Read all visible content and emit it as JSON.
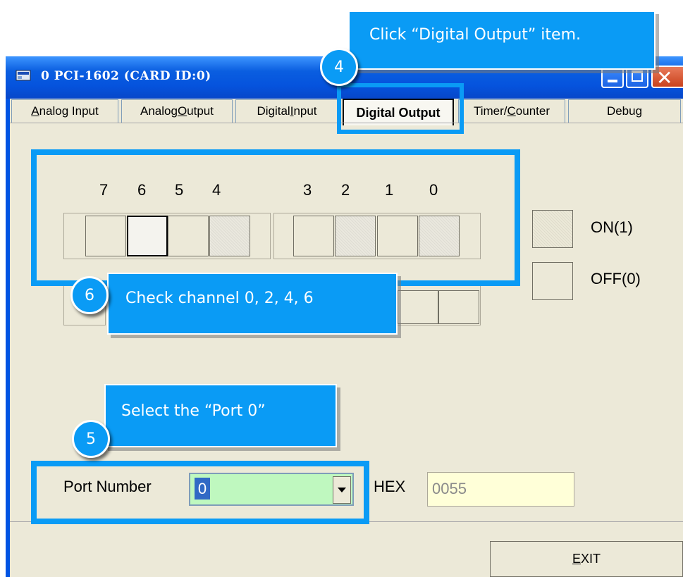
{
  "window": {
    "title": "0 PCI-1602 (CARD ID:0)",
    "close_glyph": "✕"
  },
  "tabs": [
    {
      "pre": "",
      "key": "A",
      "post": "nalog Input",
      "active": false
    },
    {
      "pre": "Analog ",
      "key": "O",
      "post": "utput",
      "active": false
    },
    {
      "pre": "Digital ",
      "key": "I",
      "post": "nput",
      "active": false
    },
    {
      "pre": "Digital Output",
      "key": "",
      "post": "",
      "active": true
    },
    {
      "pre": "Timer/",
      "key": "C",
      "post": "ounter",
      "active": false
    },
    {
      "pre": "Debug",
      "key": "",
      "post": "",
      "active": false
    }
  ],
  "bits": {
    "labels": [
      "7",
      "6",
      "5",
      "4",
      "3",
      "2",
      "1",
      "0"
    ]
  },
  "legend": {
    "on_label": "ON(1)",
    "off_label": "OFF(0)"
  },
  "port": {
    "label": "Port Number",
    "value": "0",
    "hex_label": "HEX",
    "hex_value": "0055"
  },
  "buttons": {
    "exit_pre": "",
    "exit_key": "E",
    "exit_post": "XIT"
  },
  "annotations": {
    "step4_badge": "4",
    "step4_text": "Click “Digital Output” item.",
    "step5_badge": "5",
    "step5_text": "Select the “Port 0”",
    "step6_badge": "6",
    "step6_text": "Check channel 0, 2, 4, 6"
  },
  "colors": {
    "accent": "#0a9bf5",
    "title_bar": "#0553dd",
    "port_select_bg": "#bff8bf",
    "hex_field_bg": "#ffffd8"
  }
}
